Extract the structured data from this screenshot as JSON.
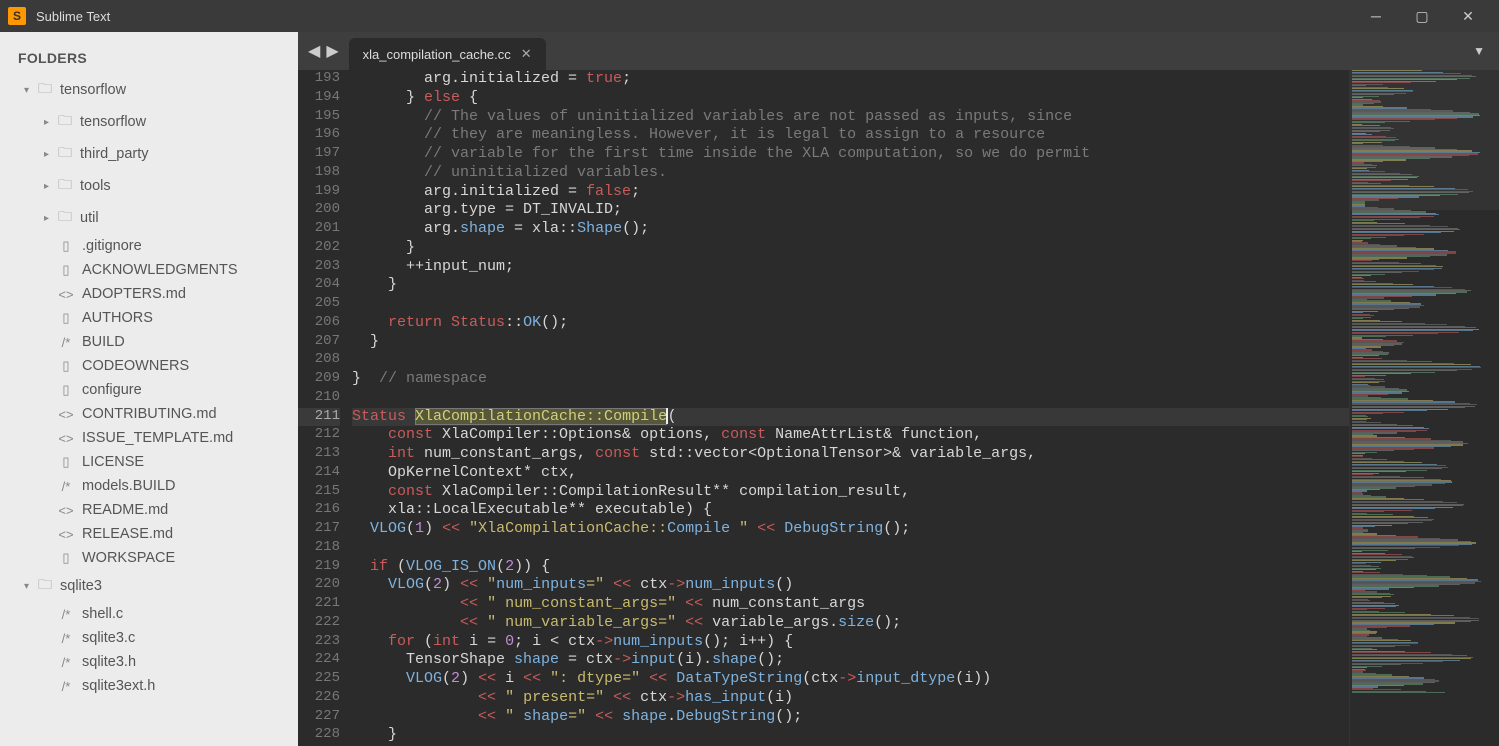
{
  "app": {
    "title": "Sublime Text"
  },
  "sidebar": {
    "header": "FOLDERS",
    "tree": [
      {
        "label": "tensorflow",
        "kind": "folder",
        "level": 1,
        "expanded": true
      },
      {
        "label": "tensorflow",
        "kind": "folder",
        "level": 2,
        "expanded": false
      },
      {
        "label": "third_party",
        "kind": "folder",
        "level": 2,
        "expanded": false
      },
      {
        "label": "tools",
        "kind": "folder",
        "level": 2,
        "expanded": false
      },
      {
        "label": "util",
        "kind": "folder",
        "level": 2,
        "expanded": false
      },
      {
        "label": ".gitignore",
        "kind": "file",
        "icon": "▯",
        "level": 2
      },
      {
        "label": "ACKNOWLEDGMENTS",
        "kind": "file",
        "icon": "▯",
        "level": 2
      },
      {
        "label": "ADOPTERS.md",
        "kind": "file",
        "icon": "<>",
        "level": 2
      },
      {
        "label": "AUTHORS",
        "kind": "file",
        "icon": "▯",
        "level": 2
      },
      {
        "label": "BUILD",
        "kind": "file",
        "icon": "/*",
        "level": 2
      },
      {
        "label": "CODEOWNERS",
        "kind": "file",
        "icon": "▯",
        "level": 2
      },
      {
        "label": "configure",
        "kind": "file",
        "icon": "▯",
        "level": 2
      },
      {
        "label": "CONTRIBUTING.md",
        "kind": "file",
        "icon": "<>",
        "level": 2
      },
      {
        "label": "ISSUE_TEMPLATE.md",
        "kind": "file",
        "icon": "<>",
        "level": 2
      },
      {
        "label": "LICENSE",
        "kind": "file",
        "icon": "▯",
        "level": 2
      },
      {
        "label": "models.BUILD",
        "kind": "file",
        "icon": "/*",
        "level": 2
      },
      {
        "label": "README.md",
        "kind": "file",
        "icon": "<>",
        "level": 2
      },
      {
        "label": "RELEASE.md",
        "kind": "file",
        "icon": "<>",
        "level": 2
      },
      {
        "label": "WORKSPACE",
        "kind": "file",
        "icon": "▯",
        "level": 2
      },
      {
        "label": "sqlite3",
        "kind": "folder",
        "level": 1,
        "expanded": true
      },
      {
        "label": "shell.c",
        "kind": "file",
        "icon": "/*",
        "level": 2
      },
      {
        "label": "sqlite3.c",
        "kind": "file",
        "icon": "/*",
        "level": 2
      },
      {
        "label": "sqlite3.h",
        "kind": "file",
        "icon": "/*",
        "level": 2
      },
      {
        "label": "sqlite3ext.h",
        "kind": "file",
        "icon": "/*",
        "level": 2
      }
    ]
  },
  "tabs": [
    {
      "label": "xla_compilation_cache.cc",
      "active": true
    }
  ],
  "editor": {
    "first_line": 193,
    "cursor_line": 211,
    "lines": [
      "        arg.initialized = true;",
      "      } else {",
      "        // The values of uninitialized variables are not passed as inputs, since",
      "        // they are meaningless. However, it is legal to assign to a resource",
      "        // variable for the first time inside the XLA computation, so we do permit",
      "        // uninitialized variables.",
      "        arg.initialized = false;",
      "        arg.type = DT_INVALID;",
      "        arg.shape = xla::Shape();",
      "      }",
      "      ++input_num;",
      "    }",
      "",
      "    return Status::OK();",
      "  }",
      "",
      "}  // namespace",
      "",
      "Status XlaCompilationCache::Compile(",
      "    const XlaCompiler::Options& options, const NameAttrList& function,",
      "    int num_constant_args, const std::vector<OptionalTensor>& variable_args,",
      "    OpKernelContext* ctx,",
      "    const XlaCompiler::CompilationResult** compilation_result,",
      "    xla::LocalExecutable** executable) {",
      "  VLOG(1) << \"XlaCompilationCache::Compile \" << DebugString();",
      "",
      "  if (VLOG_IS_ON(2)) {",
      "    VLOG(2) << \"num_inputs=\" << ctx->num_inputs()",
      "            << \" num_constant_args=\" << num_constant_args",
      "            << \" num_variable_args=\" << variable_args.size();",
      "    for (int i = 0; i < ctx->num_inputs(); i++) {",
      "      TensorShape shape = ctx->input(i).shape();",
      "      VLOG(2) << i << \": dtype=\" << DataTypeString(ctx->input_dtype(i))",
      "              << \" present=\" << ctx->has_input(i)",
      "              << \" shape=\" << shape.DebugString();",
      "    }"
    ]
  }
}
